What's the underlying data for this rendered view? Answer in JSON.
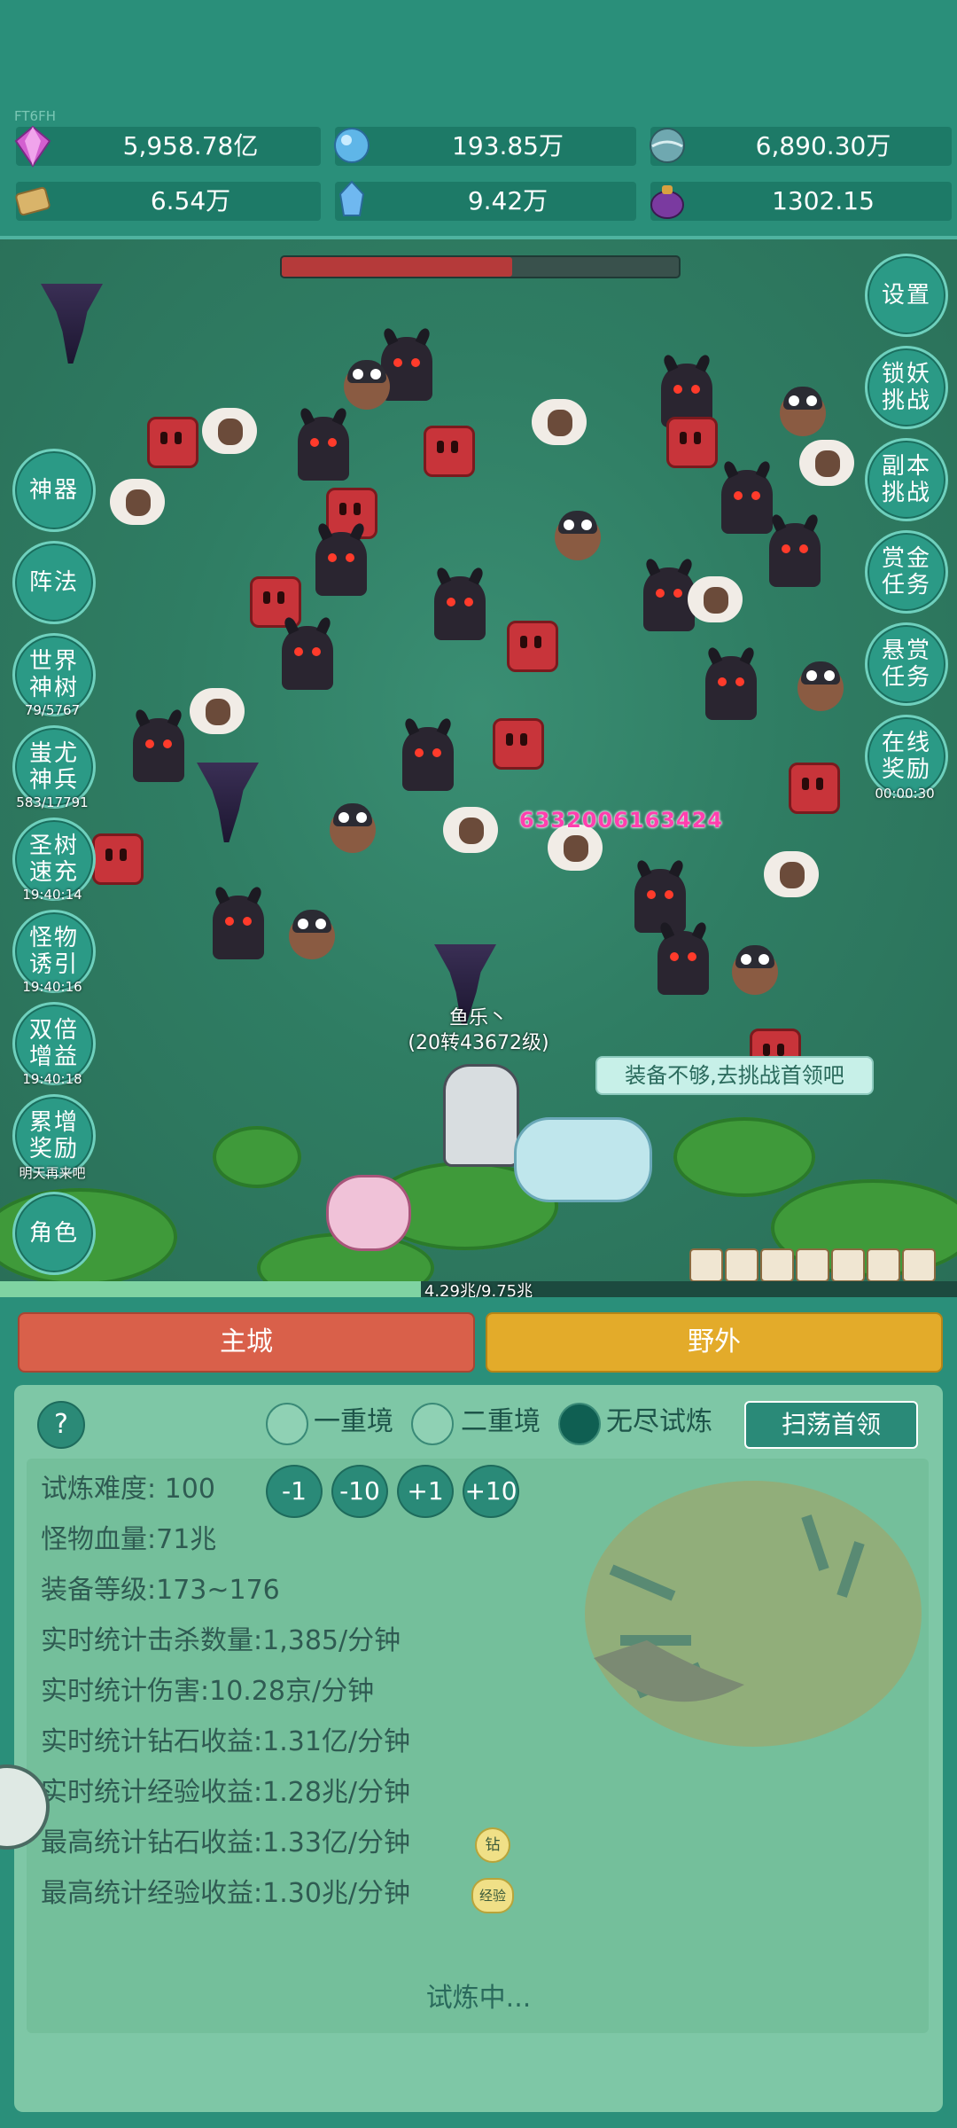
{
  "server_tag": "FT6FH",
  "resources": [
    {
      "icon": "diamond-icon",
      "value": "5,958.78亿",
      "color": "#d35fd0"
    },
    {
      "icon": "crystal-orb-icon",
      "value": "193.85万",
      "color": "#5fb6e8"
    },
    {
      "icon": "globe-orb-icon",
      "value": "6,890.30万",
      "color": "#6fa8b0"
    },
    {
      "icon": "scroll-icon",
      "value": "6.54万",
      "color": "#d9b46a"
    },
    {
      "icon": "ice-shard-icon",
      "value": "9.42万",
      "color": "#6fb8f0"
    },
    {
      "icon": "potion-bag-icon",
      "value": "1302.15",
      "color": "#7a3aa0"
    }
  ],
  "boss_hp_fraction": 0.58,
  "left_buttons": [
    {
      "label": "神器",
      "sub": ""
    },
    {
      "label": "阵法",
      "sub": ""
    },
    {
      "label": "世界神树",
      "sub": "79/5767"
    },
    {
      "label": "蚩尤神兵",
      "sub": "583/17791"
    },
    {
      "label": "圣树速充",
      "sub": "19:40:14"
    },
    {
      "label": "怪物诱引",
      "sub": "19:40:16"
    },
    {
      "label": "双倍增益",
      "sub": "19:40:18"
    },
    {
      "label": "累增奖励",
      "sub": "明天再来吧"
    },
    {
      "label": "角色",
      "sub": ""
    }
  ],
  "right_buttons": [
    {
      "label": "设置",
      "sub": ""
    },
    {
      "label": "锁妖挑战",
      "sub": ""
    },
    {
      "label": "副本挑战",
      "sub": ""
    },
    {
      "label": "赏金任务",
      "sub": ""
    },
    {
      "label": "悬赏任务",
      "sub": ""
    },
    {
      "label": "在线奖励",
      "sub": "00:00:30"
    }
  ],
  "damage_text": "6332006163424",
  "player": {
    "name": "鱼乐丶",
    "level": "(20转43672级)"
  },
  "speech": "装备不够,去挑战首领吧",
  "xp": {
    "text": "4.29兆/9.75兆",
    "fraction": 0.44
  },
  "tabs": {
    "main_city": "主城",
    "wild": "野外"
  },
  "help_label": "?",
  "modes": [
    {
      "label": "一重境",
      "selected": false
    },
    {
      "label": "二重境",
      "selected": false
    },
    {
      "label": "无尽试炼",
      "selected": true
    }
  ],
  "sweep_label": "扫荡首领",
  "difficulty": {
    "label": "试炼难度:",
    "value": "100"
  },
  "steps": [
    "-1",
    "-10",
    "+1",
    "+10"
  ],
  "stats": [
    {
      "label": "怪物血量:",
      "value": "71兆"
    },
    {
      "label": "装备等级:",
      "value": "173~176"
    },
    {
      "label": "实时统计击杀数量:",
      "value": "1,385/分钟"
    },
    {
      "label": "实时统计伤害:",
      "value": "10.28京/分钟"
    },
    {
      "label": "实时统计钻石收益:",
      "value": "1.31亿/分钟"
    },
    {
      "label": "实时统计经验收益:",
      "value": "1.28兆/分钟"
    },
    {
      "label": "最高统计钻石收益:",
      "value": "1.33亿/分钟",
      "badge": "钻"
    },
    {
      "label": "最高统计经验收益:",
      "value": "1.30兆/分钟",
      "badge": "经验"
    }
  ],
  "status": "试炼中..."
}
